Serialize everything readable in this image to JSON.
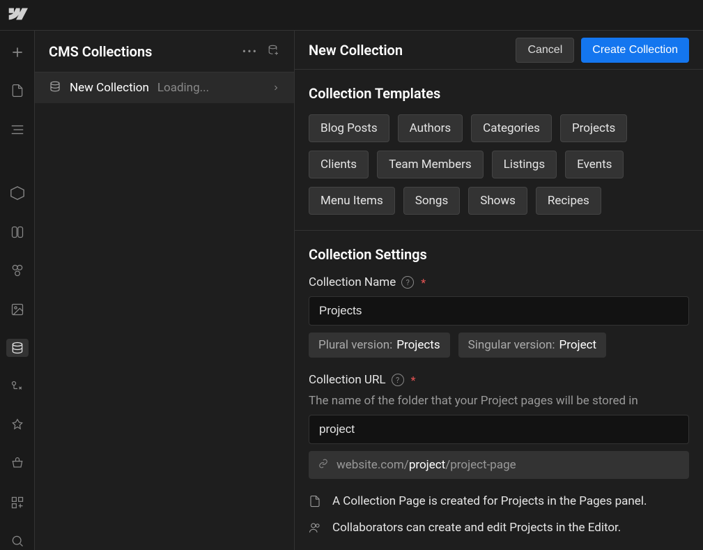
{
  "sidebar": {
    "title": "CMS Collections",
    "item": {
      "label": "New Collection",
      "status": "Loading..."
    }
  },
  "header": {
    "title": "New Collection",
    "cancel": "Cancel",
    "create": "Create Collection"
  },
  "templates": {
    "title": "Collection Templates",
    "items": [
      "Blog Posts",
      "Authors",
      "Categories",
      "Projects",
      "Clients",
      "Team Members",
      "Listings",
      "Events",
      "Menu Items",
      "Songs",
      "Shows",
      "Recipes"
    ]
  },
  "settings": {
    "title": "Collection Settings",
    "name": {
      "label": "Collection Name",
      "value": "Projects",
      "plural_label": "Plural version:",
      "plural_value": "Projects",
      "singular_label": "Singular version:",
      "singular_value": "Project"
    },
    "url": {
      "label": "Collection URL",
      "description": "The name of the folder that your Project pages will be stored in",
      "value": "project",
      "preview_domain": "website.com/",
      "preview_slug": "project",
      "preview_tail": "/project-page"
    },
    "info_page": "A Collection Page is created for Projects in the Pages panel.",
    "info_collab": "Collaborators can create and edit Projects in the Editor."
  }
}
